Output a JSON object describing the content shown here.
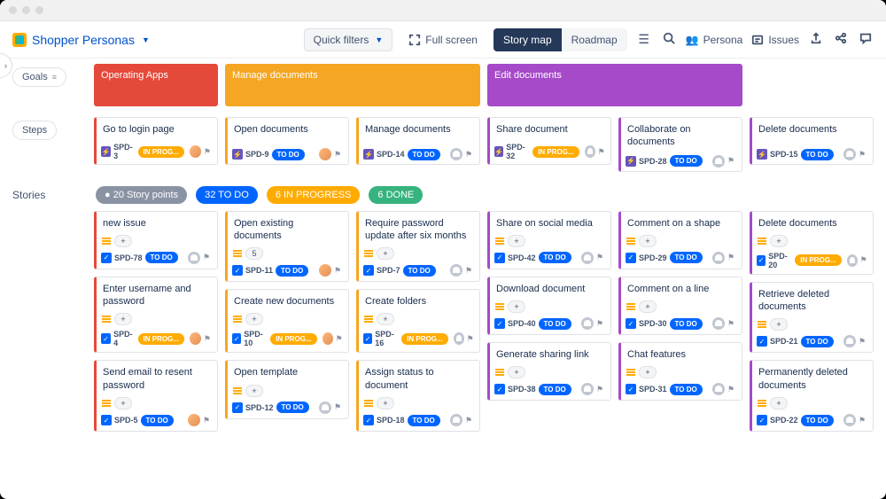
{
  "header": {
    "app_title": "Shopper Personas",
    "quick_filters": "Quick filters",
    "full_screen": "Full screen",
    "story_map": "Story map",
    "roadmap": "Roadmap",
    "persona": "Persona",
    "issues": "Issues"
  },
  "labels": {
    "goals": "Goals",
    "steps": "Steps",
    "stories": "Stories"
  },
  "goals": [
    {
      "title": "Operating Apps",
      "color": "goal-red",
      "span": 1
    },
    {
      "title": "Manage documents",
      "color": "goal-yellow",
      "span": 2
    },
    {
      "title": "",
      "color": "",
      "span": 0
    },
    {
      "title": "Edit documents",
      "color": "goal-purple",
      "span": 2
    },
    {
      "title": "",
      "color": "",
      "span": 0
    },
    {
      "title": "",
      "color": "",
      "span": 0
    }
  ],
  "steps": [
    {
      "title": "Go to login page",
      "key": "SPD-3",
      "status": "IN PROG...",
      "st": "st-prog",
      "bl": "bl-red",
      "av": "av1"
    },
    {
      "title": "Open documents",
      "key": "SPD-9",
      "status": "TO DO",
      "st": "st-todo",
      "bl": "bl-yellow",
      "av": "av1"
    },
    {
      "title": "Manage documents",
      "key": "SPD-14",
      "status": "TO DO",
      "st": "st-todo",
      "bl": "bl-yellow",
      "av": "unassigned"
    },
    {
      "title": "Share document",
      "key": "SPD-32",
      "status": "IN PROG...",
      "st": "st-prog",
      "bl": "",
      "av": "unassigned"
    },
    {
      "title": "Collaborate on documents",
      "key": "SPD-28",
      "status": "TO DO",
      "st": "st-todo",
      "bl": "",
      "av": "unassigned"
    },
    {
      "title": "Delete documents",
      "key": "SPD-15",
      "status": "TO DO",
      "st": "st-todo",
      "bl": "",
      "av": "unassigned"
    }
  ],
  "summary": {
    "points": "● 20 Story points",
    "todo": "32 TO DO",
    "prog": "6 IN PROGRESS",
    "done": "6 DONE"
  },
  "stories": [
    [
      {
        "title": "new issue",
        "key": "SPD-78",
        "status": "TO DO",
        "st": "st-todo",
        "bl": "bl-red",
        "pts": "+",
        "av": "unassigned"
      },
      {
        "title": "Enter username and password",
        "key": "SPD-4",
        "status": "IN PROG...",
        "st": "st-prog",
        "bl": "bl-red",
        "pts": "+",
        "av": "av1"
      },
      {
        "title": "Send email to resent password",
        "key": "SPD-5",
        "status": "TO DO",
        "st": "st-todo",
        "bl": "bl-red",
        "pts": "+",
        "av": "av1"
      }
    ],
    [
      {
        "title": "Open existing documents",
        "key": "SPD-11",
        "status": "TO DO",
        "st": "st-todo",
        "bl": "bl-yellow",
        "pts": "5",
        "av": "av1"
      },
      {
        "title": "Create new documents",
        "key": "SPD-10",
        "status": "IN PROG...",
        "st": "st-prog",
        "bl": "bl-yellow",
        "pts": "+",
        "av": "av1"
      },
      {
        "title": "Open template",
        "key": "SPD-12",
        "status": "TO DO",
        "st": "st-todo",
        "bl": "bl-yellow",
        "pts": "+",
        "av": "unassigned"
      }
    ],
    [
      {
        "title": "Require password update after six months",
        "key": "SPD-7",
        "status": "TO DO",
        "st": "st-todo",
        "bl": "bl-yellow",
        "pts": "+",
        "av": "unassigned"
      },
      {
        "title": "Create folders",
        "key": "SPD-16",
        "status": "IN PROG...",
        "st": "st-prog",
        "bl": "bl-yellow",
        "pts": "+",
        "av": "unassigned"
      },
      {
        "title": "Assign status to document",
        "key": "SPD-18",
        "status": "TO DO",
        "st": "st-todo",
        "bl": "bl-yellow",
        "pts": "+",
        "av": "unassigned"
      }
    ],
    [
      {
        "title": "Share on social media",
        "key": "SPD-42",
        "status": "TO DO",
        "st": "st-todo",
        "bl": "",
        "pts": "+",
        "av": "unassigned"
      },
      {
        "title": "Download document",
        "key": "SPD-40",
        "status": "TO DO",
        "st": "st-todo",
        "bl": "",
        "pts": "+",
        "av": "unassigned"
      },
      {
        "title": "Generate sharing link",
        "key": "SPD-38",
        "status": "TO DO",
        "st": "st-todo",
        "bl": "",
        "pts": "+",
        "av": "unassigned"
      }
    ],
    [
      {
        "title": "Comment on a shape",
        "key": "SPD-29",
        "status": "TO DO",
        "st": "st-todo",
        "bl": "",
        "pts": "+",
        "av": "unassigned"
      },
      {
        "title": "Comment on a line",
        "key": "SPD-30",
        "status": "TO DO",
        "st": "st-todo",
        "bl": "",
        "pts": "+",
        "av": "unassigned"
      },
      {
        "title": "Chat features",
        "key": "SPD-31",
        "status": "TO DO",
        "st": "st-todo",
        "bl": "",
        "pts": "+",
        "av": "unassigned"
      }
    ],
    [
      {
        "title": "Delete documents",
        "key": "SPD-20",
        "status": "IN PROG...",
        "st": "st-prog",
        "bl": "",
        "pts": "+",
        "av": "unassigned"
      },
      {
        "title": "Retrieve deleted documents",
        "key": "SPD-21",
        "status": "TO DO",
        "st": "st-todo",
        "bl": "",
        "pts": "+",
        "av": "unassigned"
      },
      {
        "title": "Permanently deleted documents",
        "key": "SPD-22",
        "status": "TO DO",
        "st": "st-todo",
        "bl": "",
        "pts": "+",
        "av": "unassigned"
      }
    ]
  ]
}
